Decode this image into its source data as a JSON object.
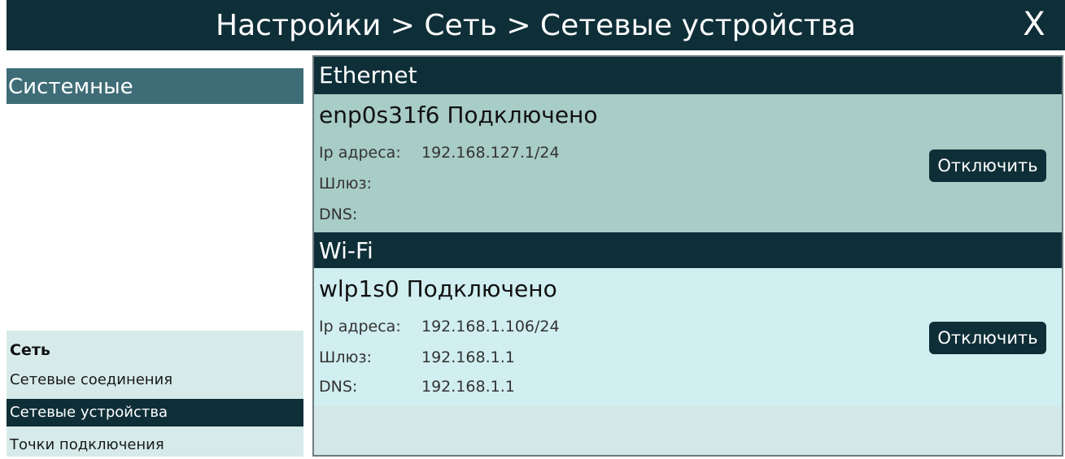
{
  "header": {
    "title": "Настройки > Сеть > Сетевые устройства",
    "close_label": "X"
  },
  "sidebar": {
    "category": "Системные",
    "section_heading": "Сеть",
    "items": [
      {
        "label": "Сетевые соединения",
        "active": false
      },
      {
        "label": "Сетевые устройства",
        "active": true
      },
      {
        "label": "Точки подключения",
        "active": false
      }
    ]
  },
  "sections": [
    {
      "header": "Ethernet",
      "device": {
        "name": "enp0s31f6 Подключено",
        "ip_label": "Ip адреса:",
        "ip_value": "192.168.127.1/24",
        "gateway_label": "Шлюз:",
        "gateway_value": "",
        "dns_label": "DNS:",
        "dns_value": "",
        "button_label": "Отключить"
      }
    },
    {
      "header": "Wi-Fi",
      "device": {
        "name": "wlp1s0 Подключено",
        "ip_label": "Ip адреса:",
        "ip_value": "192.168.1.106/24",
        "gateway_label": "Шлюз:",
        "gateway_value": "192.168.1.1",
        "dns_label": "DNS:",
        "dns_value": "192.168.1.1",
        "button_label": "Отключить"
      }
    }
  ],
  "colors": {
    "dark": "#0f2f38",
    "ethernet_bg": "#a8ccc6",
    "wifi_bg": "#d1eef0",
    "panel_bg": "#d3e8e6",
    "category_bg": "#3f6d77"
  }
}
